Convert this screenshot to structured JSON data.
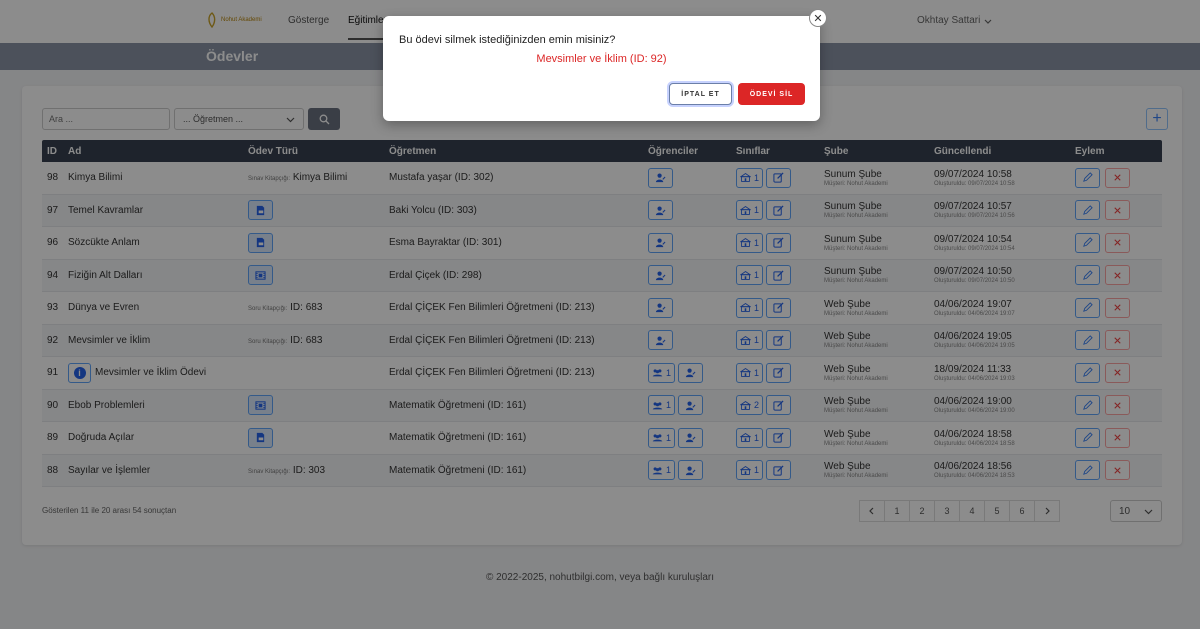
{
  "nav": {
    "logo_text": "Nohut Akademi",
    "items": [
      "Gösterge",
      "Eğitimler"
    ],
    "user": "Okhtay Sattari"
  },
  "page": {
    "title": "Ödevler"
  },
  "toolbar": {
    "search_placeholder": "Ara ...",
    "teacher_select": "... Öğretmen ..."
  },
  "table": {
    "headers": [
      "ID",
      "Ad",
      "Ödev Türü",
      "Öğretmen",
      "Öğrenciler",
      "Sınıflar",
      "Şube",
      "Güncellendi",
      "Eylem"
    ],
    "rows": [
      {
        "id": "98",
        "name": "Kimya Bilimi",
        "type_label": "Sınav Kitapçığı:",
        "type_value": "Kimya Bilimi",
        "type_icon": "",
        "teacher": "Mustafa yaşar (ID: 302)",
        "students": "",
        "classes": "1",
        "branch": "Sunum Şube",
        "customer": "Müşteri: Nohut Akademi",
        "updated": "09/07/2024 10:58",
        "created": "Oluşturuldu: 09/07/2024 10:58"
      },
      {
        "id": "97",
        "name": "Temel Kavramlar",
        "type_label": "",
        "type_value": "",
        "type_icon": "doc",
        "teacher": "Baki Yolcu (ID: 303)",
        "students": "",
        "classes": "1",
        "branch": "Sunum Şube",
        "customer": "Müşteri: Nohut Akademi",
        "updated": "09/07/2024 10:57",
        "created": "Oluşturuldu: 09/07/2024 10:56"
      },
      {
        "id": "96",
        "name": "Sözcükte Anlam",
        "type_label": "",
        "type_value": "",
        "type_icon": "doc",
        "teacher": "Esma Bayraktar (ID: 301)",
        "students": "",
        "classes": "1",
        "branch": "Sunum Şube",
        "customer": "Müşteri: Nohut Akademi",
        "updated": "09/07/2024 10:54",
        "created": "Oluşturuldu: 09/07/2024 10:54"
      },
      {
        "id": "94",
        "name": "Fiziğin Alt Dalları",
        "type_label": "",
        "type_value": "",
        "type_icon": "film",
        "teacher": "Erdal Çiçek (ID: 298)",
        "students": "",
        "classes": "1",
        "branch": "Sunum Şube",
        "customer": "Müşteri: Nohut Akademi",
        "updated": "09/07/2024 10:50",
        "created": "Oluşturuldu: 09/07/2024 10:50"
      },
      {
        "id": "93",
        "name": "Dünya ve Evren",
        "type_label": "Soru Kitapçığı:",
        "type_value": "ID: 683",
        "type_icon": "",
        "teacher": "Erdal ÇİÇEK Fen Bilimleri Öğretmeni (ID: 213)",
        "students": "",
        "classes": "1",
        "branch": "Web Şube",
        "customer": "Müşteri: Nohut Akademi",
        "updated": "04/06/2024 19:07",
        "created": "Oluşturuldu: 04/06/2024 19:07"
      },
      {
        "id": "92",
        "name": "Mevsimler ve İklim",
        "type_label": "Soru Kitapçığı:",
        "type_value": "ID: 683",
        "type_icon": "",
        "teacher": "Erdal ÇİÇEK Fen Bilimleri Öğretmeni (ID: 213)",
        "students": "",
        "classes": "1",
        "branch": "Web Şube",
        "customer": "Müşteri: Nohut Akademi",
        "updated": "04/06/2024 19:05",
        "created": "Oluşturuldu: 04/06/2024 19:05"
      },
      {
        "id": "91",
        "name": "Mevsimler ve İklim Ödevi",
        "type_label": "",
        "type_value": "",
        "type_icon": "",
        "teacher": "Erdal ÇİÇEK Fen Bilimleri Öğretmeni (ID: 213)",
        "students": "1",
        "classes": "1",
        "branch": "Web Şube",
        "customer": "Müşteri: Nohut Akademi",
        "updated": "18/09/2024 11:33",
        "created": "Oluşturuldu: 04/06/2024 19:03"
      },
      {
        "id": "90",
        "name": "Ebob Problemleri",
        "type_label": "",
        "type_value": "",
        "type_icon": "film",
        "teacher": "Matematik Öğretmeni (ID: 161)",
        "students": "1",
        "classes": "2",
        "branch": "Web Şube",
        "customer": "Müşteri: Nohut Akademi",
        "updated": "04/06/2024 19:00",
        "created": "Oluşturuldu: 04/06/2024 19:00"
      },
      {
        "id": "89",
        "name": "Doğruda Açılar",
        "type_label": "",
        "type_value": "",
        "type_icon": "doc",
        "teacher": "Matematik Öğretmeni (ID: 161)",
        "students": "1",
        "classes": "1",
        "branch": "Web Şube",
        "customer": "Müşteri: Nohut Akademi",
        "updated": "04/06/2024 18:58",
        "created": "Oluşturuldu: 04/06/2024 18:58"
      },
      {
        "id": "88",
        "name": "Sayılar ve İşlemler",
        "type_label": "Sınav Kitapçığı:",
        "type_value": "ID: 303",
        "type_icon": "",
        "teacher": "Matematik Öğretmeni (ID: 161)",
        "students": "1",
        "classes": "1",
        "branch": "Web Şube",
        "customer": "Müşteri: Nohut Akademi",
        "updated": "04/06/2024 18:56",
        "created": "Oluşturuldu: 04/06/2024 18:53"
      }
    ]
  },
  "footer": {
    "info": "Gösterilen 11 ile 20 arası 54 sonuçtan",
    "pages": [
      "1",
      "2",
      "3",
      "4",
      "5",
      "6"
    ],
    "per_page": "10",
    "copyright": "© 2022-2025, nohutbilgi.com, veya bağlı kuruluşları"
  },
  "modal": {
    "question": "Bu ödevi silmek istediğinizden emin misiniz?",
    "item": "Mevsimler ve İklim (ID: 92)",
    "cancel": "İPTAL ET",
    "delete": "ÖDEVİ SİL"
  },
  "colors": {
    "accent_blue": "#2563eb",
    "danger_red": "#dc2626",
    "header_dark": "#374151",
    "titlebar": "#8a94a6"
  }
}
